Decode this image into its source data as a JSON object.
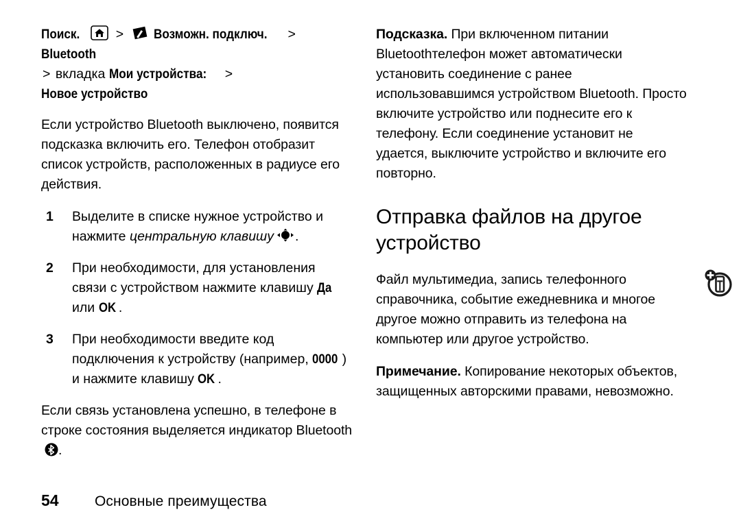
{
  "document": {
    "language": "ru",
    "page_number": "54",
    "footer_title": "Основные преимущества"
  },
  "left_column": {
    "nav_path": {
      "label": "Поиск.",
      "home_icon": "home-icon",
      "connectivity_icon": "connectivity-icon",
      "separator": ">",
      "item1": "Возможн. подключ.",
      "item2": "Bluetooth",
      "item3_prefix": "вкладка",
      "item3": "Мои устройства:",
      "item4": "Новое устройство"
    },
    "intro_paragraph": "Если устройство Bluetooth выключено, появится подсказка включить его. Телефон отобразит список устройств, расположенных в радиусе его действия.",
    "steps": [
      {
        "number": "1",
        "text_before": "Выделите в списке нужное устройство и нажмите ",
        "italic": "центральную клавишу",
        "icon": "navigation-key-icon",
        "text_after": "."
      },
      {
        "number": "2",
        "text_before": "При необходимости, для установления связи с устройством нажмите клавишу ",
        "bold1": "Да",
        "text_mid": " или ",
        "bold2": "OK",
        "text_after": "."
      },
      {
        "number": "3",
        "text_before": "При необходимости введите код подключения к устройству (например, ",
        "bold1": "0000",
        "text_mid": ") и нажмите клавишу ",
        "bold2": "OK",
        "text_after": "."
      }
    ],
    "closing_paragraph_before": "Если связь установлена успешно, в телефоне в строке состояния выделяется индикатор Bluetooth ",
    "closing_paragraph_icon": "bluetooth-icon",
    "closing_paragraph_after": "."
  },
  "right_column": {
    "tip": {
      "label": "Подсказка.",
      "text": " При включенном питании Bluetoothтелефон может автоматически установить соединение с ранее использовавшимся устройством Bluetooth. Просто включите устройство или поднесите его к телефону. Если соединение установит не удается, выключите устройство и включите его повторно."
    },
    "section_title": "Отправка файлов на другое устройство",
    "body_paragraph": "Файл мультимедиа, запись телефонного справочника, событие ежедневника и многое другое можно отправить из телефона на компьютер или другое устройство.",
    "margin_icon": "send-to-phone-icon",
    "note": {
      "label": "Примечание.",
      "text": " Копирование некоторых объектов, защищенных авторскими правами, невозможно."
    }
  },
  "colors": {
    "text": "#000000",
    "background": "#ffffff"
  }
}
